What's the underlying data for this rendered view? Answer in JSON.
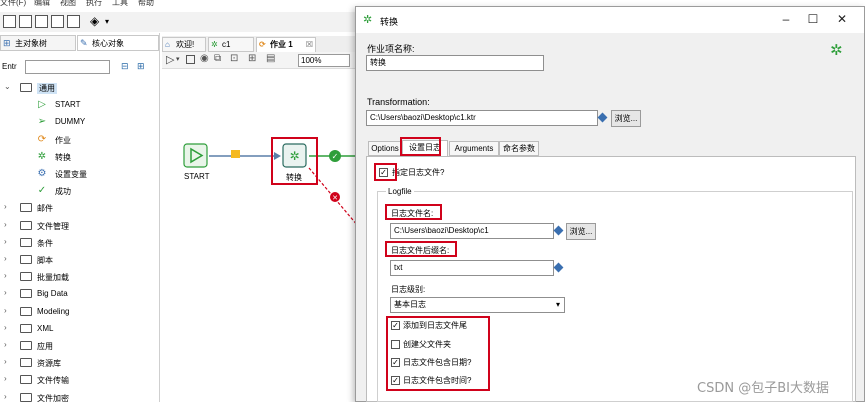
{
  "menu": [
    "文件(F)",
    "编辑",
    "视图",
    "执行",
    "工具",
    "帮助"
  ],
  "left_panel": {
    "tabs": [
      "主对象树",
      "核心对象"
    ],
    "search_label": "Entr",
    "search_value": "",
    "tree": [
      {
        "label": "通用",
        "expanded": true
      },
      {
        "label": "邮件"
      },
      {
        "label": "文件管理"
      },
      {
        "label": "条件"
      },
      {
        "label": "脚本"
      },
      {
        "label": "批量加载"
      },
      {
        "label": "Big Data"
      },
      {
        "label": "Modeling"
      },
      {
        "label": "XML"
      },
      {
        "label": "应用"
      },
      {
        "label": "资源库"
      },
      {
        "label": "文件传输"
      },
      {
        "label": "文件加密"
      }
    ],
    "general_children": [
      {
        "label": "START",
        "icon": "play-icon",
        "color": "#2e9e3a",
        "glyph": "▷"
      },
      {
        "label": "DUMMY",
        "icon": "dummy-icon",
        "color": "#2e9e3a",
        "glyph": "➢"
      },
      {
        "label": "作业",
        "icon": "job-icon",
        "color": "#e08a1e",
        "glyph": "⟳"
      },
      {
        "label": "转换",
        "icon": "transformation-icon",
        "color": "#2e9e3a",
        "glyph": "✲"
      },
      {
        "label": "设置变量",
        "icon": "set-variable-icon",
        "color": "#3a6fb0",
        "glyph": "⚙"
      },
      {
        "label": "成功",
        "icon": "success-icon",
        "color": "#2e9e3a",
        "glyph": "✓"
      }
    ]
  },
  "editor": {
    "tabs": [
      {
        "label": "欢迎!",
        "icon": "welcome-icon",
        "glyph": "⌂",
        "color": "#3a6fb0"
      },
      {
        "label": "c1",
        "icon": "transformation-icon",
        "glyph": "✲",
        "color": "#2e9e3a"
      },
      {
        "label": "作业 1",
        "icon": "job-icon",
        "glyph": "⟳",
        "color": "#e08a1e",
        "close": "☒"
      }
    ],
    "zoom": "100%",
    "nodes": {
      "start": "START",
      "transform": "转换"
    }
  },
  "dialog": {
    "title": "转换",
    "job_entry_name_label": "作业项名称:",
    "job_entry_name_value": "转换",
    "transformation_label": "Transformation:",
    "transformation_path": "C:\\Users\\baozi\\Desktop\\c1.ktr",
    "browse": "浏览...",
    "tabs": [
      "Options",
      "设置日志",
      "Arguments",
      "命名参数"
    ],
    "active_tab": "设置日志",
    "specify_logfile_label": "指定日志文件?",
    "specify_logfile_checked": true,
    "logfile_group": "Logfile",
    "logfile_name_label": "日志文件名:",
    "logfile_name_value": "C:\\Users\\baozi\\Desktop\\c1",
    "logfile_ext_label": "日志文件后缀名:",
    "logfile_ext_value": "txt",
    "log_level_label": "日志级别:",
    "log_level_value": "基本日志",
    "options": [
      {
        "label": "添加到日志文件尾",
        "checked": true
      },
      {
        "label": "创建父文件夹",
        "checked": false
      },
      {
        "label": "日志文件包含日期?",
        "checked": true
      },
      {
        "label": "日志文件包含时间?",
        "checked": true
      }
    ]
  },
  "watermark": "CSDN @包子BI大数据",
  "colors": {
    "accent": "#2e9e3a",
    "highlight": "#d0021b",
    "link": "#3a6fb0"
  }
}
